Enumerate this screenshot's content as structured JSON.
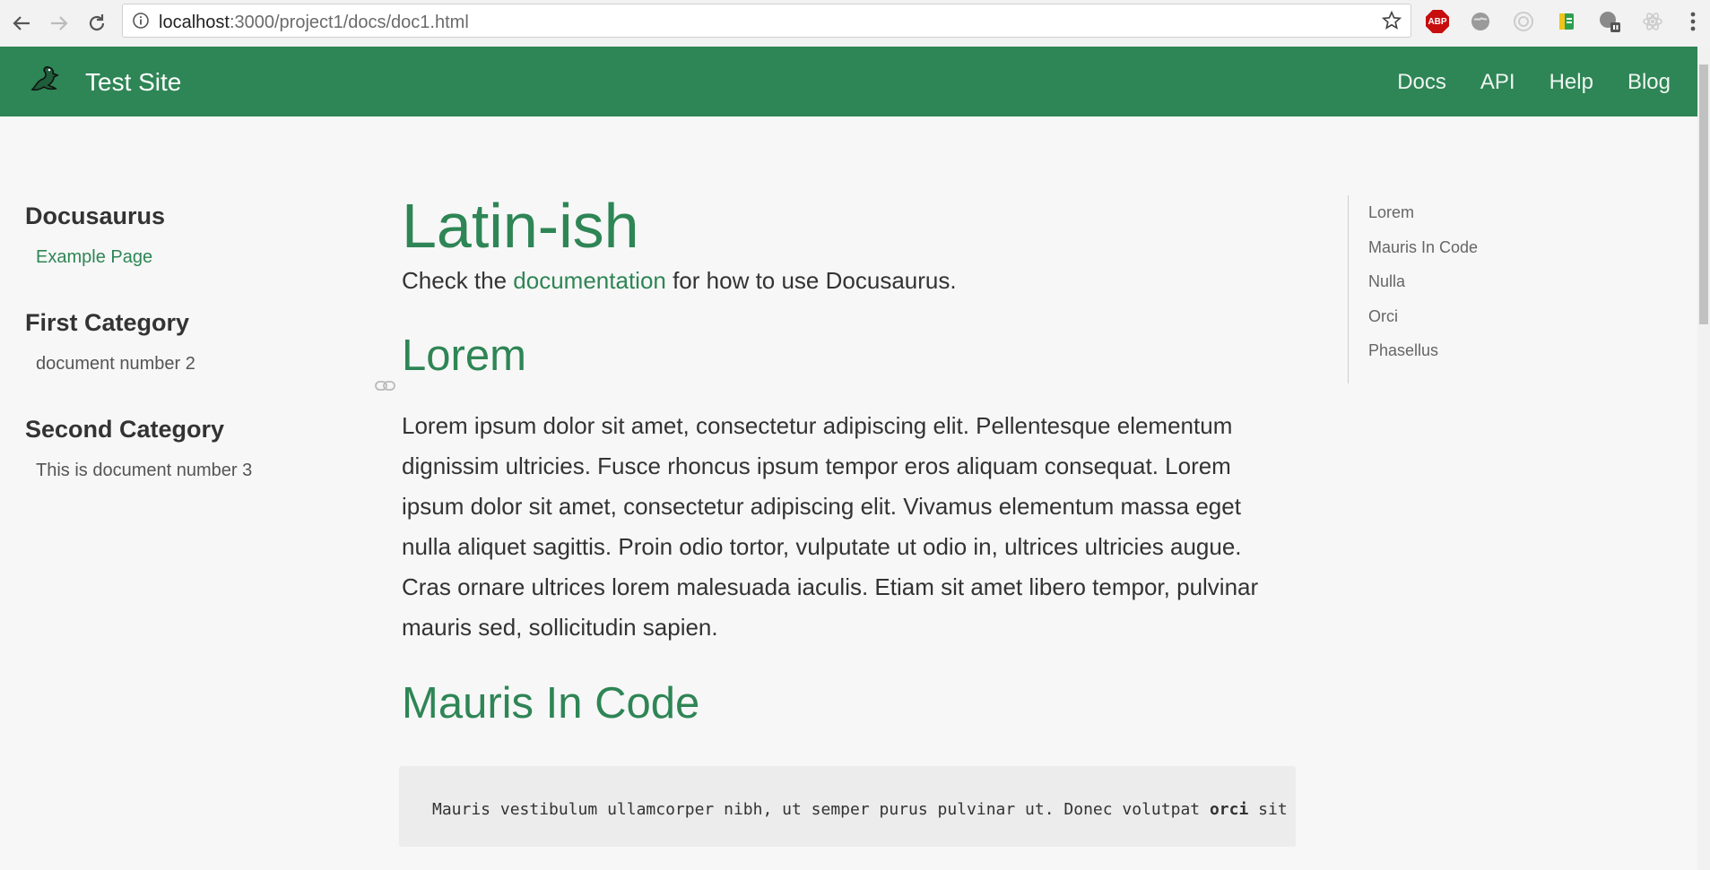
{
  "browser": {
    "url_host": "localhost",
    "url_path": ":3000/project1/docs/doc1.html",
    "abp_label": "ABP"
  },
  "header": {
    "site_title": "Test Site",
    "nav": [
      "Docs",
      "API",
      "Help",
      "Blog"
    ],
    "brand_color": "#2e8555"
  },
  "sidebar": {
    "categories": [
      {
        "title": "Docusaurus",
        "items": [
          {
            "label": "Example Page",
            "active": true
          }
        ]
      },
      {
        "title": "First Category",
        "items": [
          {
            "label": "document number 2",
            "active": false
          }
        ]
      },
      {
        "title": "Second Category",
        "items": [
          {
            "label": "This is document number 3",
            "active": false
          }
        ]
      }
    ]
  },
  "main": {
    "title": "Latin-ish",
    "intro_pre": "Check the ",
    "intro_link": "documentation",
    "intro_post": " for how to use Docusaurus.",
    "section1_heading": "Lorem",
    "section1_text": "Lorem ipsum dolor sit amet, consectetur adipiscing elit. Pellentesque elementum dignissim ultricies. Fusce rhoncus ipsum tempor eros aliquam consequat. Lorem ipsum dolor sit amet, consectetur adipiscing elit. Vivamus elementum massa eget nulla aliquet sagittis. Proin odio tortor, vulputate ut odio in, ultrices ultricies augue. Cras ornare ultrices lorem malesuada iaculis. Etiam sit amet libero tempor, pulvinar mauris sed, sollicitudin sapien.",
    "section2_heading": "Mauris In Code",
    "code_text_pre": "Mauris vestibulum ullamcorper nibh, ut semper purus pulvinar ut. Donec volutpat ",
    "code_text_bold": "orci",
    "code_text_post": " sit a"
  },
  "toc": {
    "items": [
      "Lorem",
      "Mauris In Code",
      "Nulla",
      "Orci",
      "Phasellus"
    ]
  }
}
